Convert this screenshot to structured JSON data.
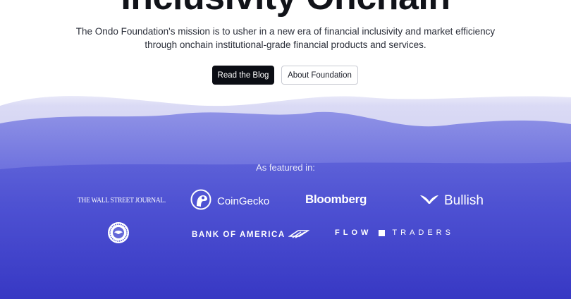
{
  "hero": {
    "title": "Inclusivity Onchain",
    "mission": "The Ondo Foundation's mission is to usher in a new era of financial inclusivity and market efficiency through onchain institutional-grade financial products and services.",
    "buttons": {
      "read_blog": "Read the Blog",
      "about": "About Foundation"
    }
  },
  "featured": {
    "heading": "As featured in:",
    "logos": {
      "wsj": "THE WALL STREET JOURNAL.",
      "coingecko": "CoinGecko",
      "bloomberg": "Bloomberg",
      "bullish": "Bullish",
      "fed_seal": "federal-reserve-seal-icon",
      "boa": "BANK OF AMERICA",
      "flow_traders_left": "FLOW",
      "flow_traders_right": "TRADERS"
    }
  },
  "colors": {
    "background_top": "#ffffff",
    "wave_light": "#c9cbf2",
    "wave_mid": "#6b6fdc",
    "wave_deep": "#3d3ec9",
    "button_dark": "#0b0d14",
    "text_dark": "#111319"
  }
}
